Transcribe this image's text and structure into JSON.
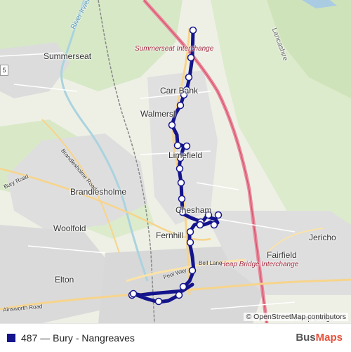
{
  "map": {
    "places": {
      "summerseat": "Summerseat",
      "carr_bank": "Carr Bank",
      "walmersley": "Walmersl",
      "limefield": "Limefield",
      "brandlesholme": "Brandlesholme",
      "woolfold": "Woolfold",
      "chesham": "Chesham",
      "fernhill": "Fernhill",
      "jericho": "Jericho",
      "fairfield": "Fairfield",
      "elton": "Elton",
      "lancashire": "Lancashire",
      "summerseat_interchange": "Summerseat Interchange",
      "heap_bridge_interchange": "Heap Bridge Interchange",
      "heap_bridge": "Heap Bridge",
      "irwell": "River Irwell"
    },
    "roads": {
      "bury_road": "Bury Road",
      "brandlesholme_road": "Brandlesholme Road",
      "ainsworth_road": "Ainsworth Road",
      "bell_lane": "Bell Lane",
      "peel_way": "Peel Way"
    },
    "shield_label": "5",
    "route_color": "#14148c",
    "attribution": "© OpenStreetMap contributors"
  },
  "legend": {
    "label": "487 — Bury - Nangreaves",
    "color": "#14148c"
  },
  "brand": {
    "part1": "Bus",
    "part2": "Maps"
  }
}
